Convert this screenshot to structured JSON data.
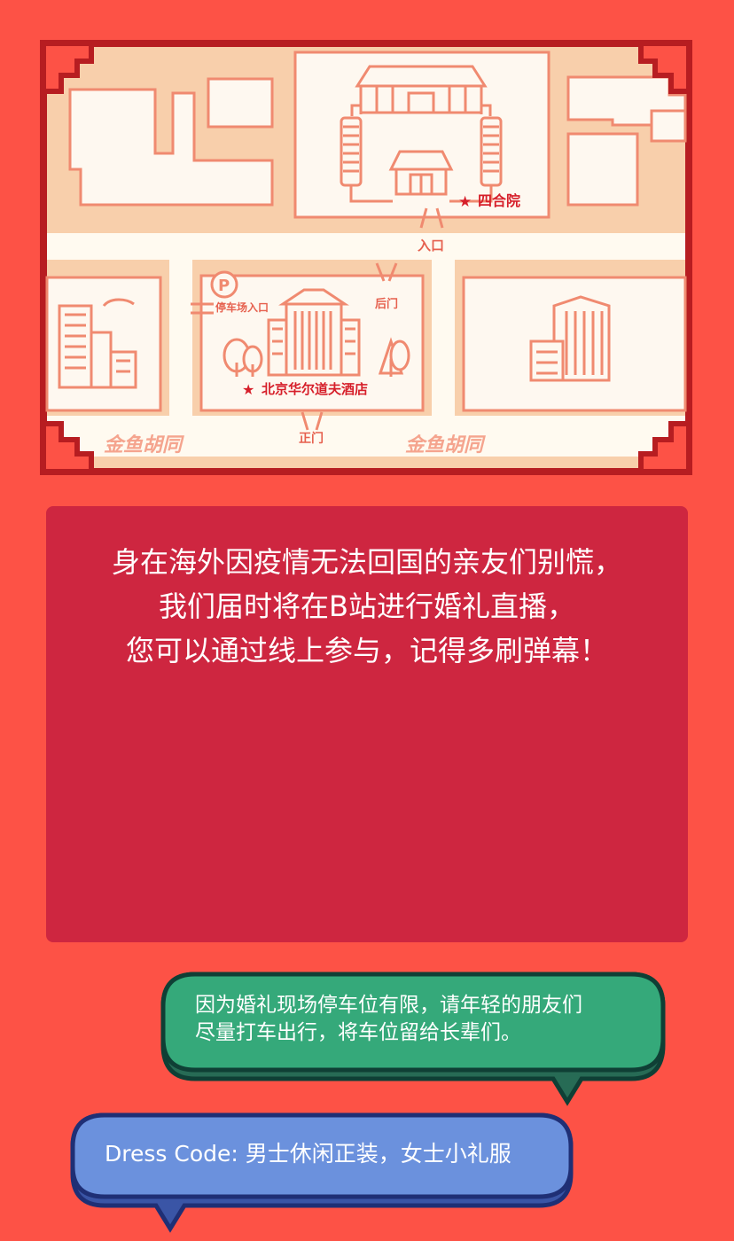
{
  "map": {
    "labels": {
      "courtyard": "四合院",
      "courtyard_entrance": "入口",
      "parking_entrance": "停车场入口",
      "parking_sign": "P",
      "back_gate": "后门",
      "hotel": "北京华尔道夫酒店",
      "main_gate": "正门",
      "street_left": "金鱼胡同",
      "street_right": "金鱼胡同"
    },
    "colors": {
      "block_fill": "#f8cfab",
      "building_fill": "#fef8f0",
      "line": "#f08a70",
      "road": "#fffaf0",
      "star": "#d61f2a",
      "frame": "#b71d21"
    }
  },
  "live_panel": {
    "lines": [
      "身在海外因疫情无法回国的亲友们别慌，",
      "我们届时将在B站进行婚礼直播，",
      "您可以通过线上参与，记得多刷弹幕！"
    ]
  },
  "parking_bubble": {
    "lines": [
      "因为婚礼现场停车位有限，请年轻的朋友们",
      "尽量打车出行，将车位留给长辈们。"
    ],
    "color": "#35a97a"
  },
  "dress_bubble": {
    "text": "Dress Code: 男士休闲正装，女士小礼服",
    "color": "#6b91dd"
  }
}
